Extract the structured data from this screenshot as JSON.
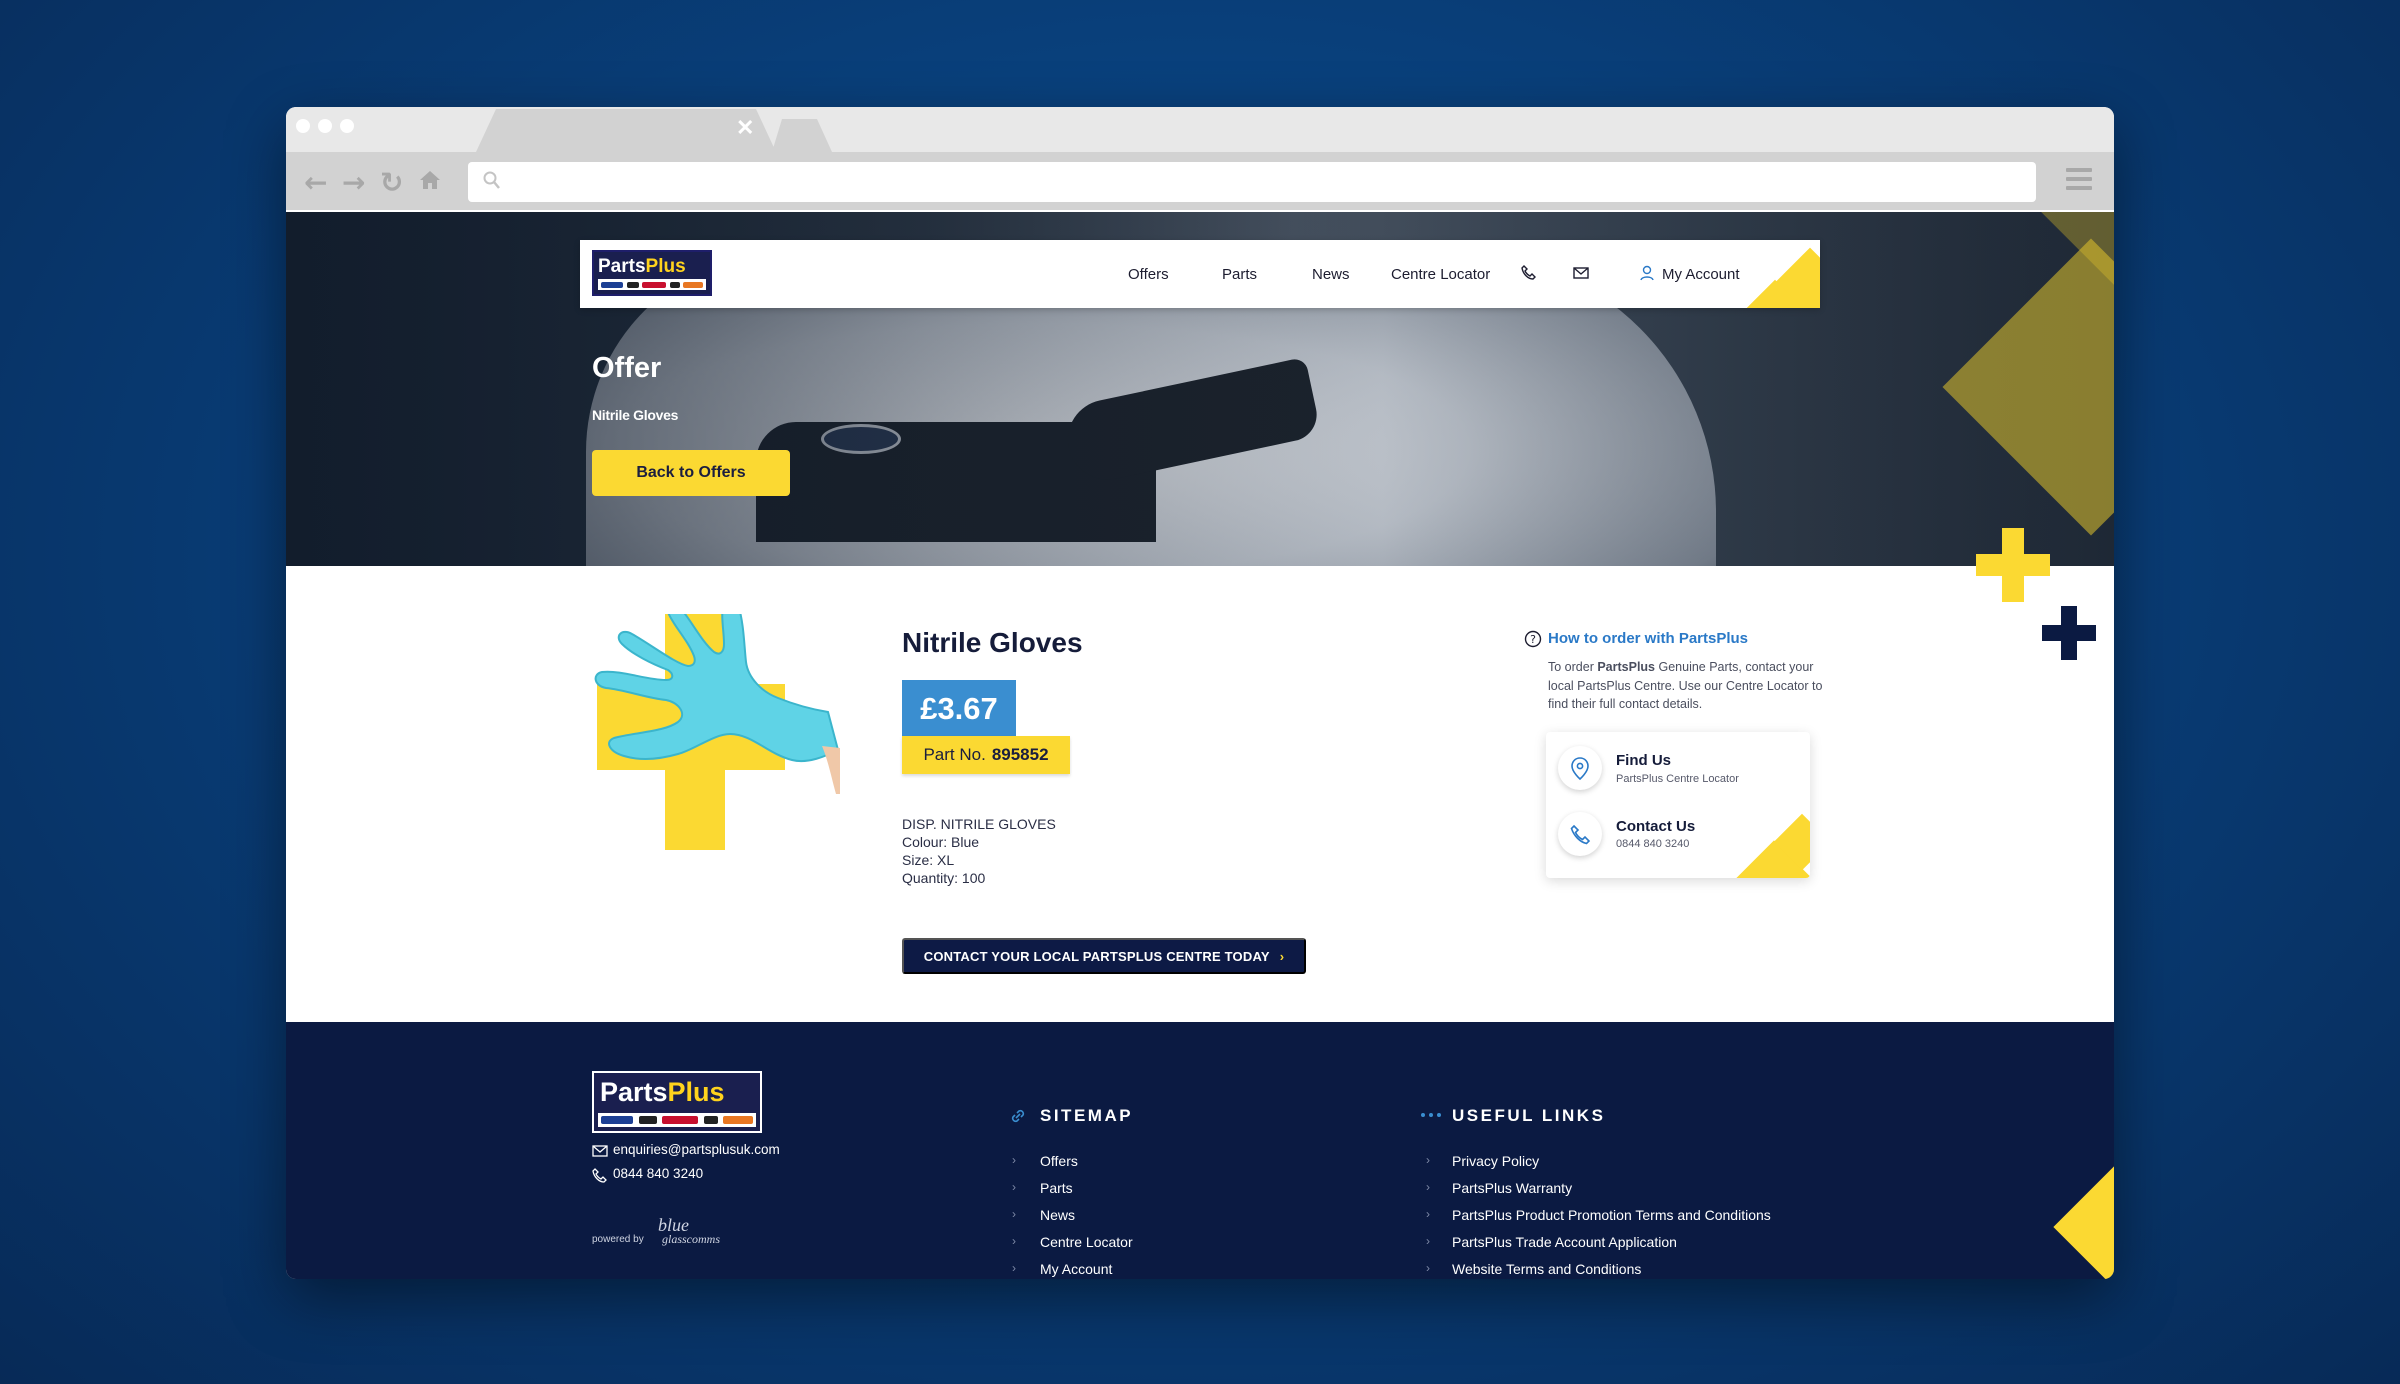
{
  "nav": {
    "logo_text_a": "Parts",
    "logo_text_b": "Plus",
    "items": [
      "Offers",
      "Parts",
      "News",
      "Centre Locator"
    ],
    "account_label": "My Account"
  },
  "hero": {
    "title": "Offer",
    "subtitle": "Nitrile Gloves",
    "back_button": "Back to Offers"
  },
  "product": {
    "title": "Nitrile Gloves",
    "price": "£3.67",
    "part_label": "Part No.",
    "part_number": "895852",
    "description": [
      "DISP. NITRILE GLOVES",
      "Colour: Blue",
      "Size: XL",
      "Quantity: 100"
    ],
    "cta": "CONTACT YOUR LOCAL PARTSPLUS CENTRE TODAY",
    "cta_chevron": "›"
  },
  "sidebar": {
    "howto_title": "How to order with PartsPlus",
    "howto_text_prefix": "To order ",
    "howto_text_bold": "PartsPlus",
    "howto_text_suffix": " Genuine Parts, contact your local PartsPlus Centre. Use our Centre Locator to find their full contact details.",
    "find_us_title": "Find Us",
    "find_us_sub": "PartsPlus Centre Locator",
    "contact_title": "Contact Us",
    "contact_sub": "0844 840 3240"
  },
  "footer": {
    "email": "enquiries@partsplusuk.com",
    "phone": "0844 840 3240",
    "powered_by": "powered by",
    "powered_brand_a": "blue",
    "powered_brand_b": "glasscomms",
    "sitemap_title": "SITEMAP",
    "sitemap_links": [
      "Offers",
      "Parts",
      "News",
      "Centre Locator",
      "My Account"
    ],
    "useful_title": "USEFUL LINKS",
    "useful_links": [
      "Privacy Policy",
      "PartsPlus Warranty",
      "PartsPlus Product Promotion Terms and Conditions",
      "PartsPlus Trade Account Application",
      "Website Terms and Conditions"
    ]
  },
  "colors": {
    "brand_navy": "#0b1a42",
    "brand_yellow": "#fbd932",
    "price_blue": "#3a8ed0",
    "link_blue": "#2a79c7"
  }
}
